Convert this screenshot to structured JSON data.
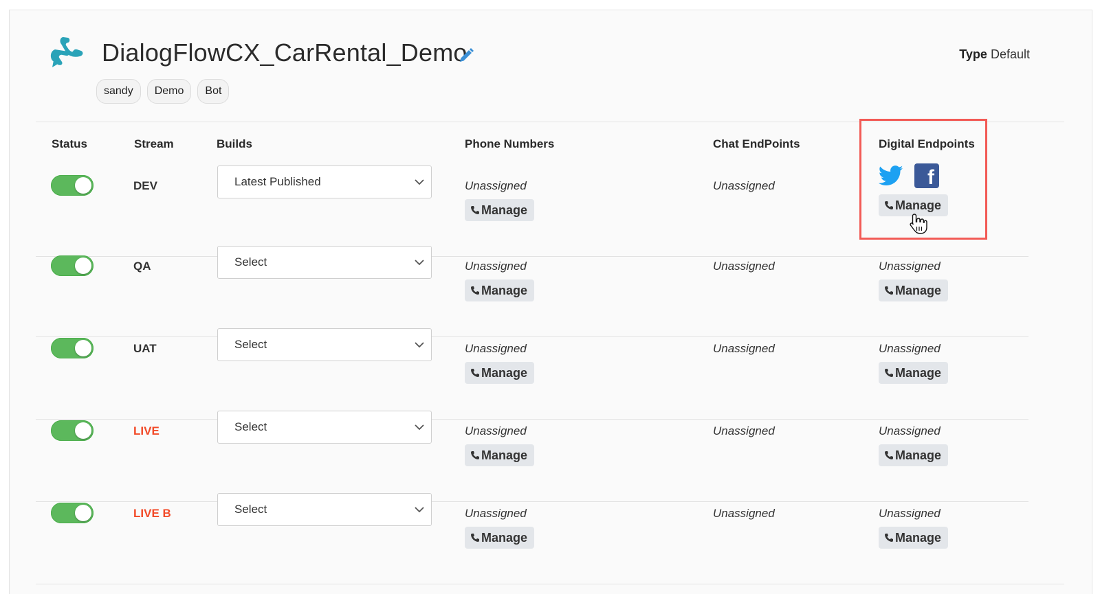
{
  "header": {
    "title": "DialogFlowCX_CarRental_Demo",
    "type_label": "Type",
    "type_value": "Default",
    "tags": [
      "sandy",
      "Demo",
      "Bot"
    ]
  },
  "columns": {
    "status": "Status",
    "stream": "Stream",
    "builds": "Builds",
    "phone_numbers": "Phone Numbers",
    "chat_endpoints": "Chat EndPoints",
    "digital_endpoints": "Digital Endpoints"
  },
  "manage_label": "Manage",
  "icons": {
    "twitter": "twitter-icon",
    "facebook": "facebook-icon",
    "facebook_glyph": "f"
  },
  "colors": {
    "toggle_on": "#5cb85c",
    "live_stream": "#f24a28",
    "highlight": "#f25a55",
    "twitter": "#1da1f2",
    "facebook": "#3b5998",
    "logo": "#2aa3b8"
  },
  "rows": [
    {
      "stream": "DEV",
      "status_on": true,
      "build": "Latest Published",
      "phone": "Unassigned",
      "chat": "Unassigned",
      "digital": ""
    },
    {
      "stream": "QA",
      "status_on": true,
      "build": "Select",
      "phone": "Unassigned",
      "chat": "Unassigned",
      "digital": "Unassigned"
    },
    {
      "stream": "UAT",
      "status_on": true,
      "build": "Select",
      "phone": "Unassigned",
      "chat": "Unassigned",
      "digital": "Unassigned"
    },
    {
      "stream": "LIVE",
      "status_on": true,
      "build": "Select",
      "phone": "Unassigned",
      "chat": "Unassigned",
      "digital": "Unassigned"
    },
    {
      "stream": "LIVE B",
      "status_on": true,
      "build": "Select",
      "phone": "Unassigned",
      "chat": "Unassigned",
      "digital": "Unassigned"
    }
  ]
}
